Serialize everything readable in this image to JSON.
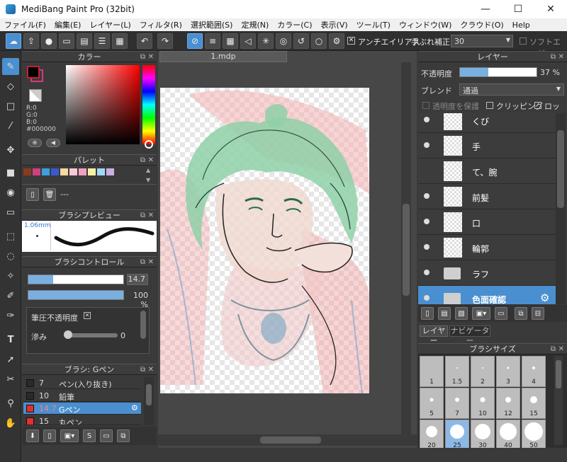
{
  "window": {
    "title": "MediBang Paint Pro (32bit)",
    "minimize": "—",
    "maximize": "☐",
    "close": "✕"
  },
  "menu": [
    "ファイル(F)",
    "編集(E)",
    "レイヤー(L)",
    "フィルタ(R)",
    "選択範囲(S)",
    "定規(N)",
    "カラー(C)",
    "表示(V)",
    "ツール(T)",
    "ウィンドウ(W)",
    "クラウド(O)",
    "Help"
  ],
  "toolbar": {
    "antialias_label": "アンチエイリアス",
    "stabilizer_label": "手ぶれ補正",
    "stabilizer_value": "30",
    "soft_edge_label": "ソフトエッジ"
  },
  "color_panel": {
    "title": "カラー",
    "r": "R:0",
    "g": "G:0",
    "b": "B:0",
    "hex": "#000000",
    "primary": "#000000",
    "secondary": "#d03a7a"
  },
  "palette_panel": {
    "title": "パレット",
    "name": "---",
    "colors": [
      "#8b3a1e",
      "#d0407a",
      "#3aa0e0",
      "#3a5ad0",
      "#f4d9a0",
      "#f8c8d8",
      "#f0a0c0",
      "#f8f0a0",
      "#a0d8f8",
      "#c8b0e0"
    ]
  },
  "brush_preview_panel": {
    "title": "ブラシプレビュー",
    "size": "1.06mm"
  },
  "brush_control_panel": {
    "title": "ブラシコントロール",
    "size_value": "14.7",
    "opacity_value": "100 %",
    "size_frac": 0.26,
    "opacity_frac": 1.0,
    "pressure_opacity": "筆圧不透明度",
    "blur_label": "滲み",
    "blur_value": "0"
  },
  "brush_list_panel": {
    "title": "ブラシ: Gペン",
    "items": [
      {
        "size": "7",
        "name": "ペン(入り抜き)",
        "color": "#2a2a2a"
      },
      {
        "size": "10",
        "name": "鉛筆",
        "color": "#2a2a2a"
      },
      {
        "size": "14.7",
        "name": "Gペン",
        "color": "#e03030"
      },
      {
        "size": "15",
        "name": "丸ペン",
        "color": "#e03030"
      }
    ]
  },
  "document": {
    "tab": "1.mdp"
  },
  "layer_panel": {
    "title": "レイヤー",
    "opacity_label": "不透明度",
    "opacity_value": "37 %",
    "opacity_frac": 0.37,
    "blend_label": "ブレンド",
    "blend_value": "通過",
    "protect_alpha": "透明度を保護",
    "clipping": "クリッピング",
    "lock": "ロック",
    "layers": [
      {
        "name": "くび",
        "type": "raster"
      },
      {
        "name": "手",
        "type": "raster"
      },
      {
        "name": "て、腕",
        "type": "raster"
      },
      {
        "name": "前髪",
        "type": "raster"
      },
      {
        "name": "口",
        "type": "raster"
      },
      {
        "name": "輪郭",
        "type": "raster"
      },
      {
        "name": "ラフ",
        "type": "folder"
      },
      {
        "name": "色面確認",
        "type": "folder"
      }
    ],
    "tab_layer": "レイヤー",
    "tab_navigator": "ナビゲーター"
  },
  "brush_size_panel": {
    "title": "ブラシサイズ",
    "sizes": [
      "1",
      "1.5",
      "2",
      "3",
      "4",
      "5",
      "7",
      "10",
      "12",
      "15",
      "20",
      "25",
      "30",
      "40",
      "50"
    ]
  }
}
